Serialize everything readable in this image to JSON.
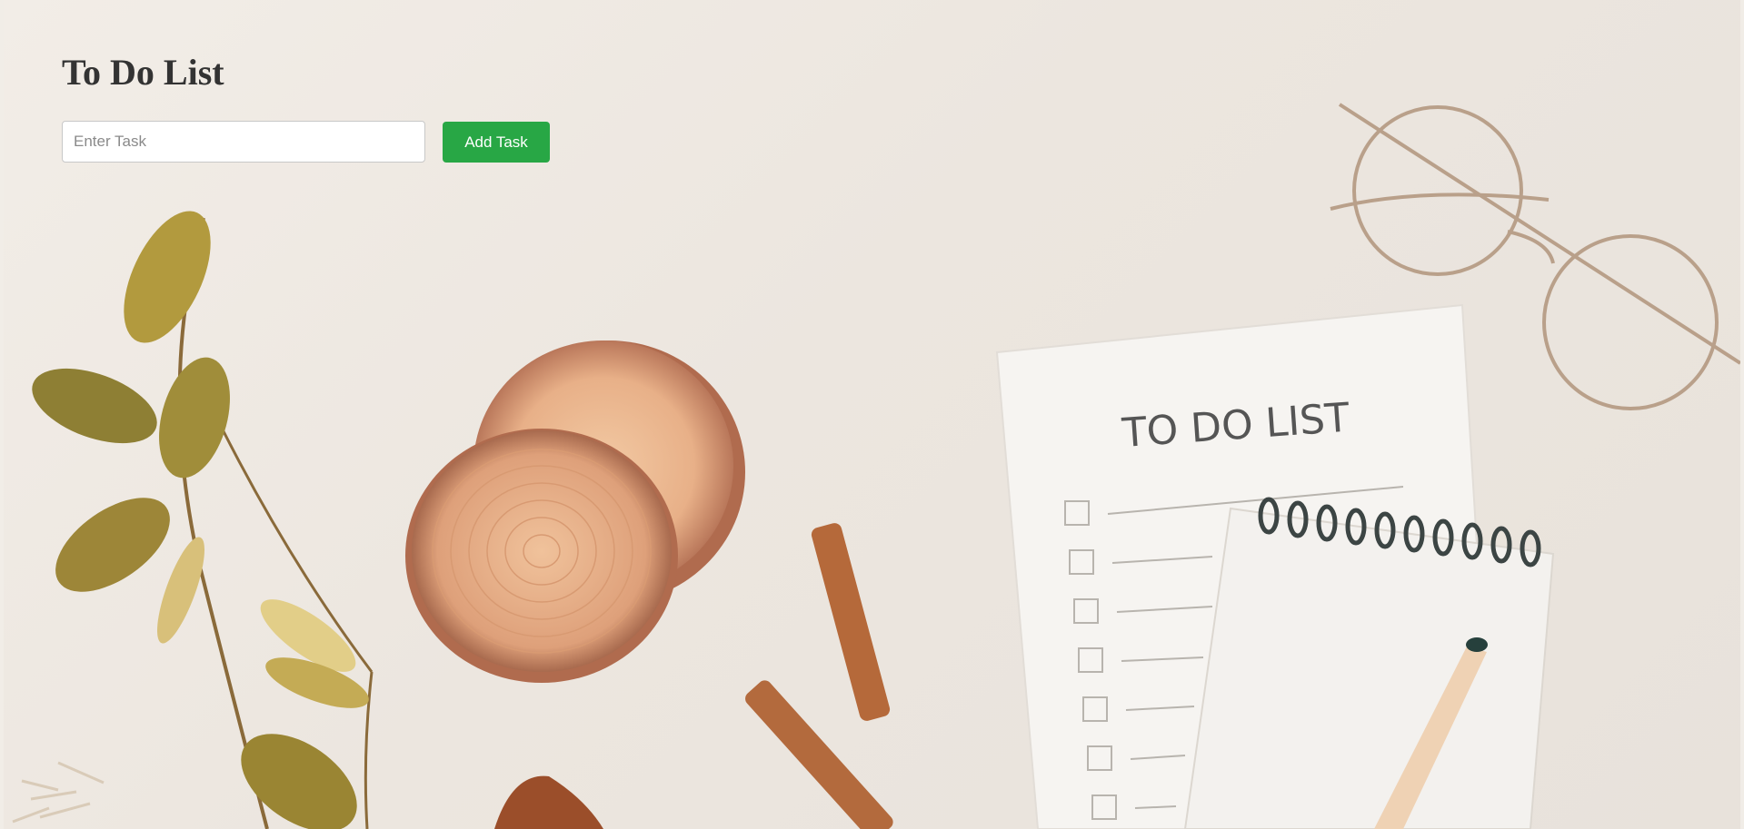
{
  "header": {
    "title": "To Do List"
  },
  "task_form": {
    "input_placeholder": "Enter Task",
    "input_value": "",
    "add_button_label": "Add Task"
  },
  "tasks": [],
  "background": {
    "icon": "desk-flatlay-photo",
    "notepad_heading": "TO DO LIST"
  },
  "colors": {
    "accent": "#28a745",
    "title": "#333333",
    "background": "#ede8e1"
  }
}
